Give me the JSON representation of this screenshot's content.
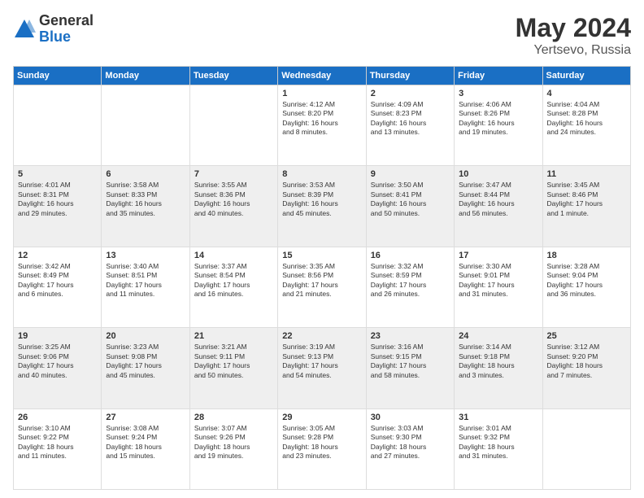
{
  "logo": {
    "general": "General",
    "blue": "Blue"
  },
  "title": {
    "month_year": "May 2024",
    "location": "Yertsevo, Russia"
  },
  "weekdays": [
    "Sunday",
    "Monday",
    "Tuesday",
    "Wednesday",
    "Thursday",
    "Friday",
    "Saturday"
  ],
  "weeks": [
    [
      {
        "day": "",
        "info": ""
      },
      {
        "day": "",
        "info": ""
      },
      {
        "day": "",
        "info": ""
      },
      {
        "day": "1",
        "info": "Sunrise: 4:12 AM\nSunset: 8:20 PM\nDaylight: 16 hours\nand 8 minutes."
      },
      {
        "day": "2",
        "info": "Sunrise: 4:09 AM\nSunset: 8:23 PM\nDaylight: 16 hours\nand 13 minutes."
      },
      {
        "day": "3",
        "info": "Sunrise: 4:06 AM\nSunset: 8:26 PM\nDaylight: 16 hours\nand 19 minutes."
      },
      {
        "day": "4",
        "info": "Sunrise: 4:04 AM\nSunset: 8:28 PM\nDaylight: 16 hours\nand 24 minutes."
      }
    ],
    [
      {
        "day": "5",
        "info": "Sunrise: 4:01 AM\nSunset: 8:31 PM\nDaylight: 16 hours\nand 29 minutes."
      },
      {
        "day": "6",
        "info": "Sunrise: 3:58 AM\nSunset: 8:33 PM\nDaylight: 16 hours\nand 35 minutes."
      },
      {
        "day": "7",
        "info": "Sunrise: 3:55 AM\nSunset: 8:36 PM\nDaylight: 16 hours\nand 40 minutes."
      },
      {
        "day": "8",
        "info": "Sunrise: 3:53 AM\nSunset: 8:39 PM\nDaylight: 16 hours\nand 45 minutes."
      },
      {
        "day": "9",
        "info": "Sunrise: 3:50 AM\nSunset: 8:41 PM\nDaylight: 16 hours\nand 50 minutes."
      },
      {
        "day": "10",
        "info": "Sunrise: 3:47 AM\nSunset: 8:44 PM\nDaylight: 16 hours\nand 56 minutes."
      },
      {
        "day": "11",
        "info": "Sunrise: 3:45 AM\nSunset: 8:46 PM\nDaylight: 17 hours\nand 1 minute."
      }
    ],
    [
      {
        "day": "12",
        "info": "Sunrise: 3:42 AM\nSunset: 8:49 PM\nDaylight: 17 hours\nand 6 minutes."
      },
      {
        "day": "13",
        "info": "Sunrise: 3:40 AM\nSunset: 8:51 PM\nDaylight: 17 hours\nand 11 minutes."
      },
      {
        "day": "14",
        "info": "Sunrise: 3:37 AM\nSunset: 8:54 PM\nDaylight: 17 hours\nand 16 minutes."
      },
      {
        "day": "15",
        "info": "Sunrise: 3:35 AM\nSunset: 8:56 PM\nDaylight: 17 hours\nand 21 minutes."
      },
      {
        "day": "16",
        "info": "Sunrise: 3:32 AM\nSunset: 8:59 PM\nDaylight: 17 hours\nand 26 minutes."
      },
      {
        "day": "17",
        "info": "Sunrise: 3:30 AM\nSunset: 9:01 PM\nDaylight: 17 hours\nand 31 minutes."
      },
      {
        "day": "18",
        "info": "Sunrise: 3:28 AM\nSunset: 9:04 PM\nDaylight: 17 hours\nand 36 minutes."
      }
    ],
    [
      {
        "day": "19",
        "info": "Sunrise: 3:25 AM\nSunset: 9:06 PM\nDaylight: 17 hours\nand 40 minutes."
      },
      {
        "day": "20",
        "info": "Sunrise: 3:23 AM\nSunset: 9:08 PM\nDaylight: 17 hours\nand 45 minutes."
      },
      {
        "day": "21",
        "info": "Sunrise: 3:21 AM\nSunset: 9:11 PM\nDaylight: 17 hours\nand 50 minutes."
      },
      {
        "day": "22",
        "info": "Sunrise: 3:19 AM\nSunset: 9:13 PM\nDaylight: 17 hours\nand 54 minutes."
      },
      {
        "day": "23",
        "info": "Sunrise: 3:16 AM\nSunset: 9:15 PM\nDaylight: 17 hours\nand 58 minutes."
      },
      {
        "day": "24",
        "info": "Sunrise: 3:14 AM\nSunset: 9:18 PM\nDaylight: 18 hours\nand 3 minutes."
      },
      {
        "day": "25",
        "info": "Sunrise: 3:12 AM\nSunset: 9:20 PM\nDaylight: 18 hours\nand 7 minutes."
      }
    ],
    [
      {
        "day": "26",
        "info": "Sunrise: 3:10 AM\nSunset: 9:22 PM\nDaylight: 18 hours\nand 11 minutes."
      },
      {
        "day": "27",
        "info": "Sunrise: 3:08 AM\nSunset: 9:24 PM\nDaylight: 18 hours\nand 15 minutes."
      },
      {
        "day": "28",
        "info": "Sunrise: 3:07 AM\nSunset: 9:26 PM\nDaylight: 18 hours\nand 19 minutes."
      },
      {
        "day": "29",
        "info": "Sunrise: 3:05 AM\nSunset: 9:28 PM\nDaylight: 18 hours\nand 23 minutes."
      },
      {
        "day": "30",
        "info": "Sunrise: 3:03 AM\nSunset: 9:30 PM\nDaylight: 18 hours\nand 27 minutes."
      },
      {
        "day": "31",
        "info": "Sunrise: 3:01 AM\nSunset: 9:32 PM\nDaylight: 18 hours\nand 31 minutes."
      },
      {
        "day": "",
        "info": ""
      }
    ]
  ]
}
